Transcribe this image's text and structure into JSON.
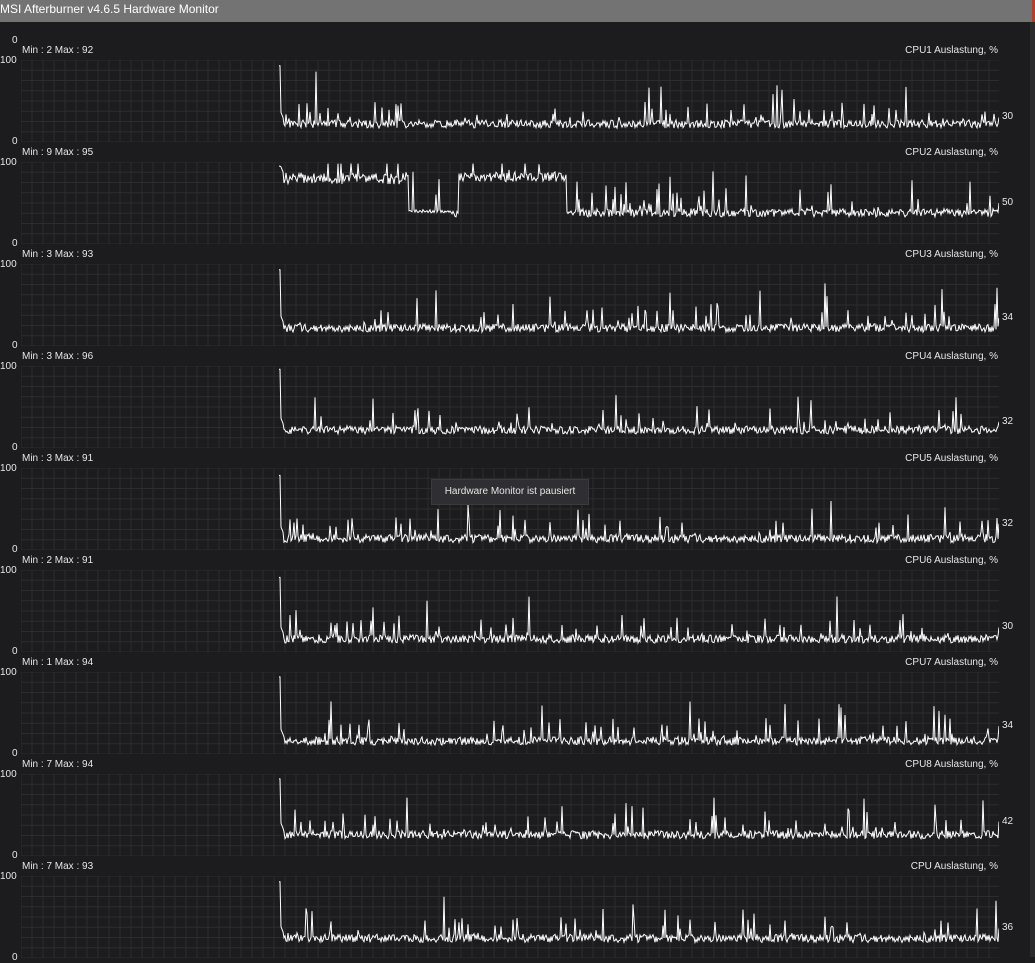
{
  "window": {
    "title": "MSI Afterburner v4.6.5 Hardware Monitor"
  },
  "axis": {
    "top_label": "0",
    "max_label": "100",
    "min_label": "0"
  },
  "tooltip": "Hardware Monitor ist pausiert",
  "colors": {
    "background": "#1c1c1e",
    "grid": "#2c2c30",
    "line": "#ffffff",
    "titlebar": "#737373"
  },
  "panels": [
    {
      "name": "CPU1 Auslastung, %",
      "minmax": "Min : 2   Max : 92",
      "current": "30",
      "current_value": 30,
      "baseline": 22,
      "spike": 93,
      "seed": 11,
      "features": []
    },
    {
      "name": "CPU2 Auslastung, %",
      "minmax": "Min : 9   Max : 95",
      "current": "50",
      "current_value": 50,
      "baseline": 38,
      "spike": 95,
      "seed": 23,
      "features": [
        {
          "from": 0.0,
          "to": 0.18,
          "level": 80,
          "amp": 14
        },
        {
          "from": 0.18,
          "to": 0.24,
          "level": 40,
          "amp": 4
        },
        {
          "from": 0.25,
          "to": 0.4,
          "level": 82,
          "amp": 12
        }
      ]
    },
    {
      "name": "CPU3 Auslastung, %",
      "minmax": "Min : 3   Max : 93",
      "current": "34",
      "current_value": 34,
      "baseline": 22,
      "spike": 93,
      "seed": 37,
      "features": []
    },
    {
      "name": "CPU4 Auslastung, %",
      "minmax": "Min : 3   Max : 96",
      "current": "32",
      "current_value": 32,
      "baseline": 22,
      "spike": 96,
      "seed": 41,
      "features": []
    },
    {
      "name": "CPU5 Auslastung, %",
      "minmax": "Min : 3   Max : 91",
      "current": "32",
      "current_value": 32,
      "baseline": 14,
      "spike": 91,
      "seed": 53,
      "features": []
    },
    {
      "name": "CPU6 Auslastung, %",
      "minmax": "Min : 2   Max : 91",
      "current": "30",
      "current_value": 30,
      "baseline": 16,
      "spike": 91,
      "seed": 67,
      "features": []
    },
    {
      "name": "CPU7 Auslastung, %",
      "minmax": "Min : 1   Max : 94",
      "current": "34",
      "current_value": 34,
      "baseline": 16,
      "spike": 94,
      "seed": 71,
      "features": []
    },
    {
      "name": "CPU8 Auslastung, %",
      "minmax": "Min : 7   Max : 94",
      "current": "42",
      "current_value": 42,
      "baseline": 26,
      "spike": 94,
      "seed": 89,
      "features": []
    },
    {
      "name": "CPU Auslastung, %",
      "minmax": "Min : 7   Max : 93",
      "current": "36",
      "current_value": 36,
      "baseline": 24,
      "spike": 93,
      "seed": 97,
      "features": []
    }
  ]
}
